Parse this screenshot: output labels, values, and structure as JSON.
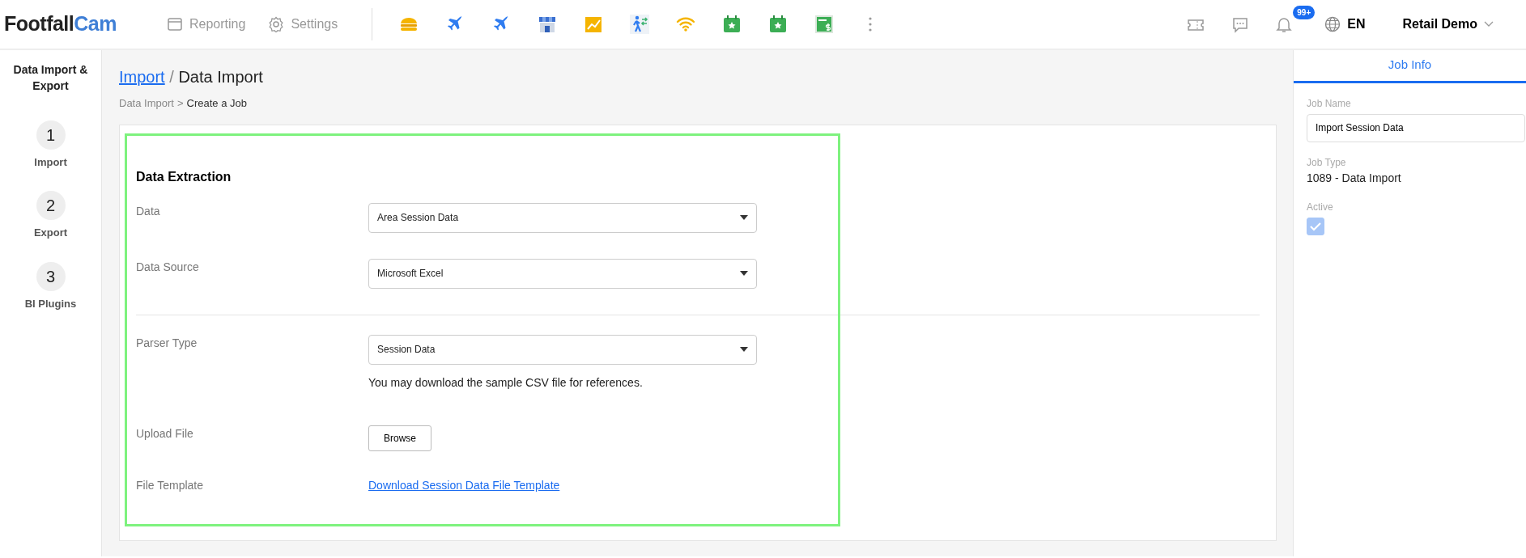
{
  "brand": {
    "first": "Footfall",
    "second": "Cam"
  },
  "nav": [
    {
      "kind": "window",
      "label": "Reporting"
    },
    {
      "kind": "gear",
      "label": "Settings"
    }
  ],
  "app_shortcuts": [
    {
      "kind": "burger"
    },
    {
      "kind": "plane"
    },
    {
      "kind": "plane"
    },
    {
      "kind": "store"
    },
    {
      "kind": "chart"
    },
    {
      "kind": "walker"
    },
    {
      "kind": "wifi"
    },
    {
      "kind": "calendar"
    },
    {
      "kind": "calendar"
    },
    {
      "kind": "sheet"
    },
    {
      "kind": "more"
    }
  ],
  "notifications": {
    "badge": "99+"
  },
  "language": "EN",
  "account": "Retail Demo",
  "sidebar": {
    "title": "Data Import & Export",
    "steps": [
      {
        "number": "1",
        "label": "Import"
      },
      {
        "number": "2",
        "label": "Export"
      },
      {
        "number": "3",
        "label": "BI Plugins"
      }
    ]
  },
  "page": {
    "title_link": "Import",
    "separator": "/",
    "title": "Data Import",
    "breadcrumb": [
      {
        "label": "Data Import",
        "current": false
      },
      {
        "label": ">",
        "current": false
      },
      {
        "label": "Create a Job",
        "current": true
      }
    ]
  },
  "form": {
    "heading": "Data Extraction",
    "sections": [
      {
        "rows": [
          {
            "kind": "select",
            "label": "Data",
            "value": "Area Session Data"
          },
          {
            "kind": "select",
            "label": "Data Source",
            "value": "Microsoft Excel"
          }
        ]
      },
      {
        "rows": [
          {
            "kind": "select",
            "label": "Parser Type",
            "value": "Session Data",
            "note": "You may download the sample CSV file for references."
          },
          {
            "kind": "button",
            "label": "Upload File",
            "value": "Browse"
          },
          {
            "kind": "link",
            "label": "File Template",
            "value": "Download Session Data File Template"
          }
        ]
      }
    ]
  },
  "job_info": {
    "tabs": [
      {
        "label": "Job Info",
        "selected": true
      }
    ],
    "job_name": {
      "label": "Job Name",
      "value": "Import Session Data"
    },
    "job_type": {
      "label": "Job Type",
      "value": "1089 - Data Import"
    },
    "active": {
      "label": "Active",
      "checked": true,
      "disabled": true
    }
  }
}
